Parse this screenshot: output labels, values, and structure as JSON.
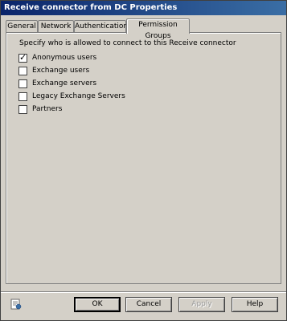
{
  "window": {
    "title": "Receive connector from DC Properties"
  },
  "tabs": [
    {
      "label": "General"
    },
    {
      "label": "Network"
    },
    {
      "label": "Authentication"
    },
    {
      "label": "Permission Groups"
    }
  ],
  "active_tab": "Permission Groups",
  "panel": {
    "description": "Specify who is allowed to connect to this Receive connector",
    "options": [
      {
        "label": "Anonymous users",
        "checked": true
      },
      {
        "label": "Exchange users",
        "checked": false
      },
      {
        "label": "Exchange servers",
        "checked": false
      },
      {
        "label": "Legacy Exchange Servers",
        "checked": false
      },
      {
        "label": "Partners",
        "checked": false
      }
    ]
  },
  "buttons": {
    "ok": "OK",
    "cancel": "Cancel",
    "apply": "Apply",
    "help": "Help"
  },
  "icons": {
    "help": "help-page-icon"
  }
}
